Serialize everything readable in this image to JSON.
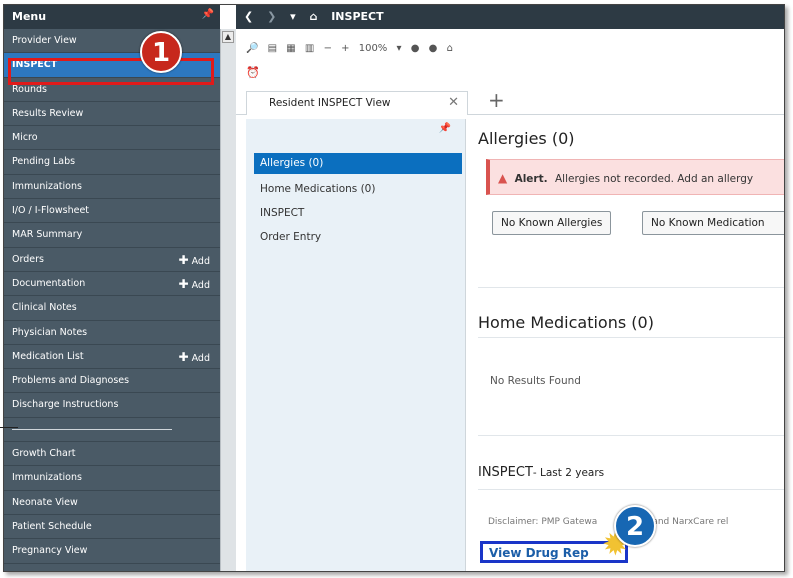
{
  "menu": {
    "title": "Menu",
    "pin_icon": "pin-icon",
    "items": [
      {
        "label": "Provider View"
      },
      {
        "label": "INSPECT",
        "active": true
      },
      {
        "label": "Rounds"
      },
      {
        "label": "Results Review"
      },
      {
        "label": "Micro"
      },
      {
        "label": "Pending Labs"
      },
      {
        "label": "Immunizations"
      },
      {
        "label": "I/O / I-Flowsheet"
      },
      {
        "label": "MAR Summary"
      },
      {
        "label": "Orders",
        "add": "Add"
      },
      {
        "label": "Documentation",
        "add": "Add"
      },
      {
        "label": "Clinical Notes"
      },
      {
        "label": "Physician Notes"
      },
      {
        "label": "Medication List",
        "add": "Add"
      },
      {
        "label": "Problems and Diagnoses"
      },
      {
        "label": "Discharge Instructions"
      },
      {
        "label": "Growth Chart"
      },
      {
        "label": "Immunizations"
      },
      {
        "label": "Neonate View"
      },
      {
        "label": "Patient Schedule"
      },
      {
        "label": "Pregnancy View"
      }
    ]
  },
  "header": {
    "back_icon": "back-arrow-icon",
    "forward_icon": "forward-arrow-icon",
    "home_icon": "home-icon",
    "title": "INSPECT"
  },
  "toolbar": {
    "zoom": "100%",
    "tools": "▓ ■ ■ ■ | ⌕ ⌕ |"
  },
  "tab": {
    "label": "Resident INSPECT View",
    "close": "✕",
    "add": "+"
  },
  "nav": {
    "items": [
      {
        "label": "Allergies (0)",
        "active": true
      },
      {
        "label": "Home Medications (0)"
      },
      {
        "label": "INSPECT"
      },
      {
        "label": "Order Entry"
      }
    ]
  },
  "allergies": {
    "title": "Allergies",
    "count": "(0)",
    "alert_label": "Alert.",
    "alert_text": "Allergies not recorded. Add an allergy",
    "button1": "No Known Allergies",
    "button2": "No Known Medication"
  },
  "home_meds": {
    "title": "Home Medications",
    "count": "(0)",
    "empty": "No Results Found"
  },
  "inspect": {
    "title": "INSPECT",
    "subtitle": "- Last 2 years",
    "disclaimer": "Disclaimer: PMP Gatewa",
    "disclaimer_tail": "ECK, and NarxCare rel",
    "view_drug_report": "View Drug Rep"
  },
  "callouts": {
    "one": "1",
    "two": "2",
    "highlight_color": "#e01a1a",
    "badge1_color": "#c7281c",
    "badge2_color": "#1767b3"
  }
}
